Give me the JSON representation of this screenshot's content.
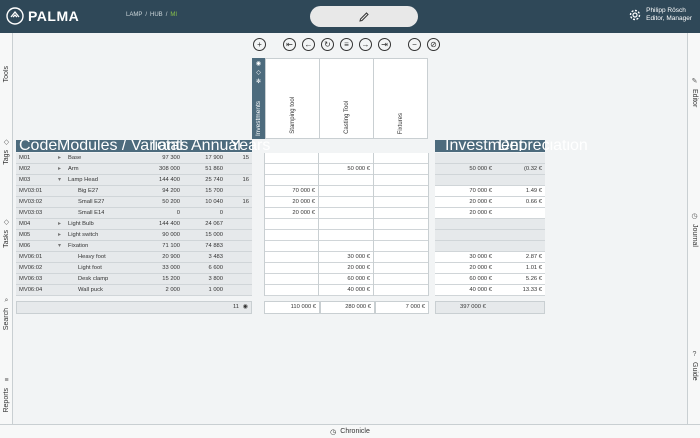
{
  "app": {
    "name": "PALMA"
  },
  "breadcrumb": [
    "LAMP",
    "HUB",
    "MI"
  ],
  "user": {
    "name": "Philipp Rösch",
    "role": "Editor, Manager"
  },
  "left_rail": [
    "Tools",
    "Tags",
    "Tasks",
    "Search",
    "Reports"
  ],
  "right_rail": [
    "Editor",
    "Journal",
    "Guide"
  ],
  "bottom": {
    "label": "Chronicle"
  },
  "phases": {
    "side_label": "Investments",
    "columns": [
      "Stamping tool",
      "Casting Tool",
      "Fixtures"
    ]
  },
  "left_headers": {
    "code": "Code",
    "modules": "Modules / Variants",
    "total": "Total",
    "annual": "Annual",
    "years": "Years"
  },
  "right_headers": {
    "investment": "Investment",
    "depreciation": "Depreciation"
  },
  "rows": [
    {
      "code": "M01",
      "name": "Base",
      "expander": "▸",
      "total": "97 300",
      "annual": "17 900",
      "years": "15",
      "c1": "",
      "c2": "",
      "c3": "",
      "inv": "",
      "dep": "",
      "sub": false
    },
    {
      "code": "M02",
      "name": "Arm",
      "expander": "▸",
      "total": "308 000",
      "annual": "51 860",
      "years": "",
      "c1": "",
      "c2": "50 000 €",
      "c3": "",
      "inv": "50 000 €",
      "dep": "(0.32 €",
      "sub": false
    },
    {
      "code": "M03",
      "name": "Lamp Head",
      "expander": "▾",
      "total": "144 400",
      "annual": "25 740",
      "years": "16",
      "c1": "",
      "c2": "",
      "c3": "",
      "inv": "",
      "dep": "",
      "sub": false
    },
    {
      "code": "MV03:01",
      "name": "Big E27",
      "expander": "",
      "total": "94 200",
      "annual": "15 700",
      "years": "",
      "c1": "70 000 €",
      "c2": "",
      "c3": "",
      "inv": "70 000 €",
      "dep": "1.49 €",
      "sub": true
    },
    {
      "code": "MV03:02",
      "name": "Small E27",
      "expander": "",
      "total": "50 200",
      "annual": "10 040",
      "years": "16",
      "c1": "20 000 €",
      "c2": "",
      "c3": "",
      "inv": "20 000 €",
      "dep": "0.66 €",
      "sub": true
    },
    {
      "code": "MV03:03",
      "name": "Small E14",
      "expander": "",
      "total": "0",
      "annual": "0",
      "years": "",
      "c1": "20 000 €",
      "c2": "",
      "c3": "",
      "inv": "20 000 €",
      "dep": "",
      "sub": true
    },
    {
      "code": "M04",
      "name": "Light Bulb",
      "expander": "▸",
      "total": "144 400",
      "annual": "24 067",
      "years": "",
      "c1": "",
      "c2": "",
      "c3": "",
      "inv": "",
      "dep": "",
      "sub": false
    },
    {
      "code": "M05",
      "name": "Light switch",
      "expander": "▸",
      "total": "90 000",
      "annual": "15 000",
      "years": "",
      "c1": "",
      "c2": "",
      "c3": "",
      "inv": "",
      "dep": "",
      "sub": false
    },
    {
      "code": "M06",
      "name": "Fixation",
      "expander": "▾",
      "total": "71 100",
      "annual": "74 883",
      "years": "",
      "c1": "",
      "c2": "",
      "c3": "",
      "inv": "",
      "dep": "",
      "sub": false
    },
    {
      "code": "MV06:01",
      "name": "Heavy foot",
      "expander": "",
      "total": "20 900",
      "annual": "3 483",
      "years": "",
      "c1": "",
      "c2": "30 000 €",
      "c3": "",
      "inv": "30 000 €",
      "dep": "2.87 €",
      "sub": true
    },
    {
      "code": "MV06:02",
      "name": "Light foot",
      "expander": "",
      "total": "33 000",
      "annual": "6 600",
      "years": "",
      "c1": "",
      "c2": "20 000 €",
      "c3": "",
      "inv": "20 000 €",
      "dep": "1.01 €",
      "sub": true
    },
    {
      "code": "MV06:03",
      "name": "Desk clamp",
      "expander": "",
      "total": "15 200",
      "annual": "3 800",
      "years": "",
      "c1": "",
      "c2": "60 000 €",
      "c3": "",
      "inv": "60 000 €",
      "dep": "5.26 €",
      "sub": true
    },
    {
      "code": "MV06:04",
      "name": "Wall puck",
      "expander": "",
      "total": "2 000",
      "annual": "1 000",
      "years": "",
      "c1": "",
      "c2": "40 000 €",
      "c3": "",
      "inv": "40 000 €",
      "dep": "13.33 €",
      "sub": true
    }
  ],
  "totals": {
    "count": "11",
    "c1": "110 000 €",
    "c2": "280 000 €",
    "c3": "7 000 €",
    "investment": "397 000 €"
  }
}
